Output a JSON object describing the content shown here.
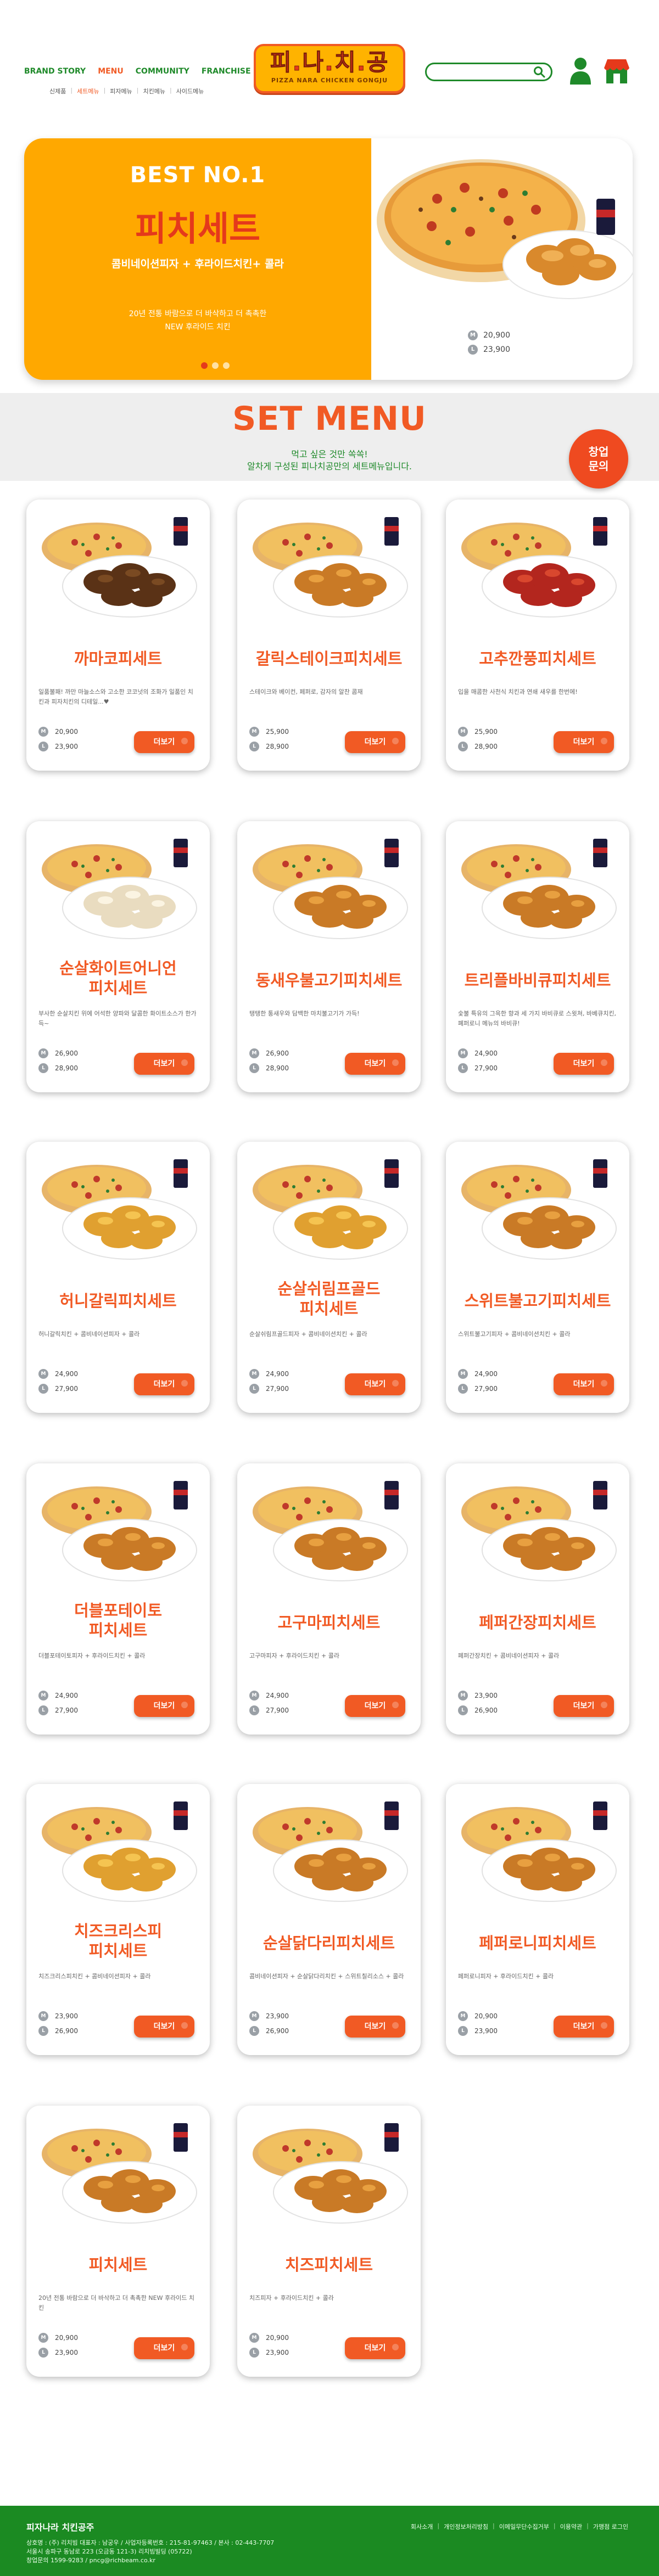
{
  "header": {
    "nav": [
      "BRAND STORY",
      "MENU",
      "COMMUNITY",
      "FRANCHISE"
    ],
    "active_nav": 1,
    "subnav": [
      "신제품",
      "세트메뉴",
      "피자메뉴",
      "치킨메뉴",
      "사이드메뉴"
    ],
    "active_sub": 1,
    "logo_title": "피.나.치.공",
    "logo_sub": "PIZZA NARA CHICKEN GONGJU",
    "search_placeholder": "",
    "accent_green": "#1f8a2a",
    "accent_orange": "#f15a24"
  },
  "hero": {
    "best": "BEST NO.1",
    "title": "피치세트",
    "desc": "콤비네이션피자 + 후라이드치킨+ 콜라",
    "copy_line1": "20년 전통 바람으로 더 바삭하고 더 촉촉한",
    "copy_line2": "NEW 후라이드 치킨",
    "price_m": "20,900",
    "price_l": "23,900",
    "size_m": "M",
    "size_l": "L",
    "slides": 3,
    "active_slide": 0
  },
  "set_menu": {
    "title": "SET MENU",
    "sub1": "먹고 싶은 것만 쏙쏙!",
    "sub2": "알차게 구성된 피나치공만의 세트메뉴입니다.",
    "franchise_line1": "창업",
    "franchise_line2": "문의",
    "detail_label": "더보기"
  },
  "cards": [
    {
      "title": "까마코피세트",
      "desc": "일품불패! 까만 마늘소스와 고소한 코코넛의 조화가 일품인 치킨과 피자치킨의 디테일...♥",
      "m": "20,900",
      "l": "23,900",
      "img": "chicken-dark"
    },
    {
      "title": "갈릭스테이크피치세트",
      "desc": "스테이크와 베이컨, 페퍼로, 감자의 알찬 콤재",
      "m": "25,900",
      "l": "28,900",
      "img": "fried"
    },
    {
      "title": "고추깐풍피치세트",
      "desc": "입을 매콤한 사천식 치킨과 연쇄 새우를 한번에!",
      "m": "25,900",
      "l": "28,900",
      "img": "spicy"
    },
    {
      "title": "순살화이트어니언\n피치세트",
      "desc": "부사한 순살치킨 위에 어석한 양파와 달콤한 화이트소스가 한가득~",
      "m": "26,900",
      "l": "28,900",
      "img": "onion"
    },
    {
      "title": "동새우불고기피치세트",
      "desc": "탱탱한 통새우와 담백한 마치불고기가 가득!",
      "m": "26,900",
      "l": "28,900",
      "img": "fried"
    },
    {
      "title": "트리플바비큐피치세트",
      "desc": "숯불 특유의 그윽한 향과 세 가지 바비큐로 스윗쳐, 바베큐치킨, 폐퍼로니 메뉴의 바비큐!",
      "m": "24,900",
      "l": "27,900",
      "img": "fried"
    },
    {
      "title": "허니갈릭피치세트",
      "desc": "허니갈릭치킨 + 콤비네이션피자 + 콜라",
      "m": "24,900",
      "l": "27,900",
      "img": "honey"
    },
    {
      "title": "순살쉬림프골드\n피치세트",
      "desc": "순살쉬림프골드피자 + 콤비네이션치킨 + 콜라",
      "m": "24,900",
      "l": "27,900",
      "img": "honey"
    },
    {
      "title": "스위트불고기피치세트",
      "desc": "스위트불고기피자 + 콤비네이션치킨 + 콜라",
      "m": "24,900",
      "l": "27,900",
      "img": "fried"
    },
    {
      "title": "더블포테이토\n피치세트",
      "desc": "더블포테이토피자 + 후라이드치킨 + 콜라",
      "m": "24,900",
      "l": "27,900",
      "img": "fried"
    },
    {
      "title": "고구마피치세트",
      "desc": "고구마피자 + 후라이드치킨 + 콜라",
      "m": "24,900",
      "l": "27,900",
      "img": "fried"
    },
    {
      "title": "페퍼간장피치세트",
      "desc": "페퍼간장치킨 + 콤비네이션피자 + 콜라",
      "m": "23,900",
      "l": "26,900",
      "img": "fried"
    },
    {
      "title": "치즈크리스피\n피치세트",
      "desc": "치즈크리스피치킨 + 콤비네이션피자 + 콜라",
      "m": "23,900",
      "l": "26,900",
      "img": "honey"
    },
    {
      "title": "순살닭다리피치세트",
      "desc": "콤비네이션피자 + 순살닭다리치킨 + 스위트칠리소스 + 콜라",
      "m": "23,900",
      "l": "26,900",
      "img": "fried"
    },
    {
      "title": "페퍼로니피치세트",
      "desc": "페퍼로니피자 + 후라이드치킨 + 콜라",
      "m": "20,900",
      "l": "23,900",
      "img": "fried"
    },
    {
      "title": "피치세트",
      "desc": "20년 전통 바람으로 더 바삭하고 더 촉촉한 NEW 후라이드 치킨",
      "m": "20,900",
      "l": "23,900",
      "img": "fried"
    },
    {
      "title": "치즈피치세트",
      "desc": "치즈피자 + 후라이드치킨 + 콜라",
      "m": "20,900",
      "l": "23,900",
      "img": "fried"
    }
  ],
  "footer": {
    "brand": "피자나라 치킨공주",
    "line1": "상호명 : (주) 리치빔 대표자 : 남궁우   /   사업자등록번호 : 215-81-97463   /   본사 : 02-443-7707",
    "line2": "서울시 송파구 동남로 223 (오금동 121-3) 리치빔빌딩 (05722)",
    "line3": "창업문의 1599-9283   /   pncg@richbeam.co.kr",
    "links": [
      "회사소개",
      "개인정보처리방침",
      "이메일무단수집거부",
      "이용약관",
      "가맹점 로그인"
    ]
  }
}
